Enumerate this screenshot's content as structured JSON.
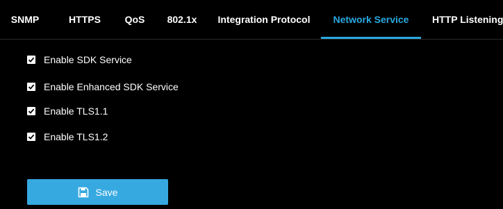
{
  "tabs": [
    {
      "label": "SNMP",
      "active": false
    },
    {
      "label": "HTTPS",
      "active": false
    },
    {
      "label": "QoS",
      "active": false
    },
    {
      "label": "802.1x",
      "active": false
    },
    {
      "label": "Integration Protocol",
      "active": false
    },
    {
      "label": "Network Service",
      "active": true
    },
    {
      "label": "HTTP Listening",
      "active": false
    }
  ],
  "options": [
    {
      "label": "Enable SDK Service",
      "checked": true
    },
    {
      "label": "Enable Enhanced SDK Service",
      "checked": true
    },
    {
      "label": "Enable TLS1.1",
      "checked": true
    },
    {
      "label": "Enable TLS1.2",
      "checked": true
    }
  ],
  "save_button": {
    "label": "Save",
    "icon": "floppy-disk-icon"
  },
  "colors": {
    "accent": "#29a9e1",
    "background": "#000000",
    "button": "#36a9e1"
  }
}
